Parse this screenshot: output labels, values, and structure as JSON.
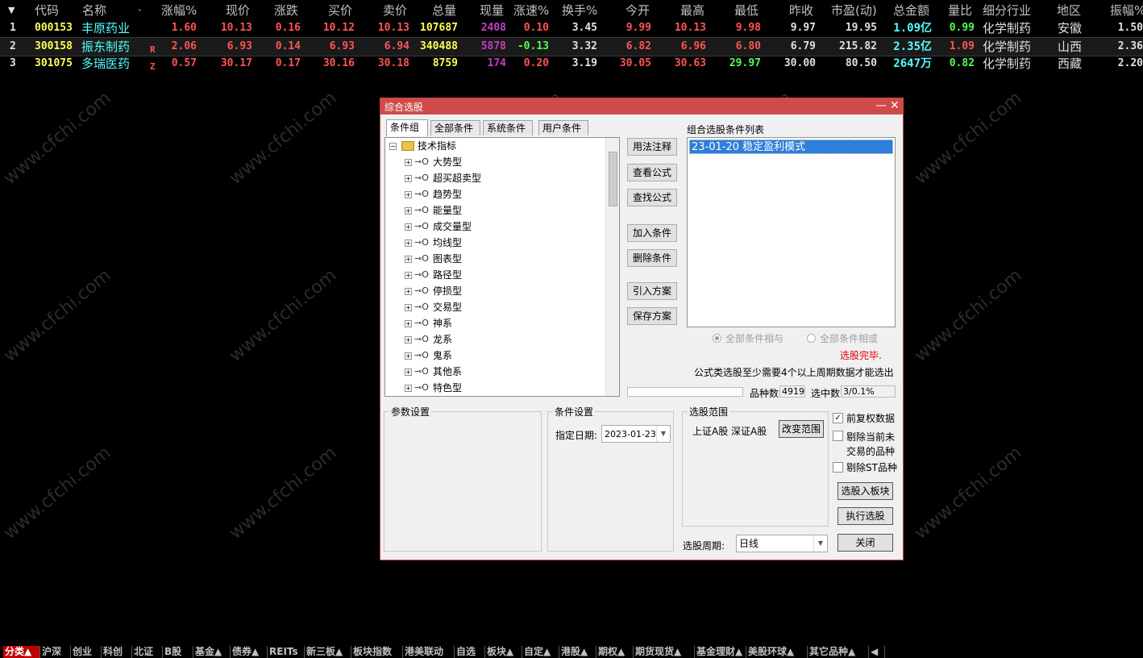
{
  "colors": {
    "yellow": "#ffff54",
    "cyan": "#54ffff",
    "red": "#ff5454",
    "green": "#54ff54",
    "magenta": "#c040c0",
    "white": "#e0e0e0",
    "grey": "#c0c0c0"
  },
  "table": {
    "headers": {
      "arrow": "▼",
      "code": "代码",
      "name": "名称",
      "dot": "·",
      "pct": "涨幅%",
      "price": "现价",
      "chg": "涨跌",
      "bid": "买价",
      "ask": "卖价",
      "vol": "总量",
      "cur": "现量",
      "speed": "涨速%",
      "turn": "换手%",
      "open": "今开",
      "high": "最高",
      "low": "最低",
      "prev": "昨收",
      "pe": "市盈(动)",
      "amt": "总金额",
      "vr": "量比",
      "ind": "细分行业",
      "area": "地区",
      "amp": "振幅%"
    },
    "rows": [
      {
        "idx": "1",
        "code": "000153",
        "name": "丰原药业",
        "flag": "",
        "pct": "1.60",
        "price": "10.13",
        "chg": "0.16",
        "bid": "10.12",
        "ask": "10.13",
        "vol": "107687",
        "cur": "2408",
        "speed": "0.10",
        "turn": "3.45",
        "open": "9.99",
        "high": "10.13",
        "low": "9.98",
        "prev": "9.97",
        "pe": "19.95",
        "amt": "1.09亿",
        "vr": "0.99",
        "ind": "化学制药",
        "area": "安徽",
        "amp": "1.50"
      },
      {
        "idx": "2",
        "code": "300158",
        "name": "振东制药",
        "flag": "R",
        "pct": "2.06",
        "price": "6.93",
        "chg": "0.14",
        "bid": "6.93",
        "ask": "6.94",
        "vol": "340488",
        "cur": "5878",
        "speed": "-0.13",
        "turn": "3.32",
        "open": "6.82",
        "high": "6.96",
        "low": "6.80",
        "prev": "6.79",
        "pe": "215.82",
        "amt": "2.35亿",
        "vr": "1.09",
        "ind": "化学制药",
        "area": "山西",
        "amp": "2.36"
      },
      {
        "idx": "3",
        "code": "301075",
        "name": "多瑞医药",
        "flag": "Z",
        "pct": "0.57",
        "price": "30.17",
        "chg": "0.17",
        "bid": "30.16",
        "ask": "30.18",
        "vol": "8759",
        "cur": "174",
        "speed": "0.20",
        "turn": "3.19",
        "open": "30.05",
        "high": "30.63",
        "low": "29.97",
        "prev": "30.00",
        "pe": "80.50",
        "amt": "2647万",
        "vr": "0.82",
        "ind": "化学制药",
        "area": "西藏",
        "amp": "2.20"
      }
    ]
  },
  "watermark": "www.cfchi.com",
  "dialog": {
    "title": "综合选股",
    "minimize": "—",
    "close": "✕",
    "tabs": [
      "条件组",
      "全部条件",
      "系统条件",
      "用户条件"
    ],
    "tree_root": "技术指标",
    "tree_items": [
      "大势型",
      "超买超卖型",
      "趋势型",
      "能量型",
      "成交量型",
      "均线型",
      "图表型",
      "路径型",
      "停损型",
      "交易型",
      "神系",
      "龙系",
      "鬼系",
      "其他系",
      "特色型"
    ],
    "buttons": {
      "usage": "用法注释",
      "view": "查看公式",
      "find": "查找公式",
      "add": "加入条件",
      "delete": "删除条件",
      "import": "引入方案",
      "save": "保存方案",
      "change_range": "改变范围",
      "to_block": "选股入板块",
      "execute": "执行选股",
      "close": "关闭"
    },
    "list_title": "组合选股条件列表",
    "list_items": [
      "23-01-20 稳定盈利模式"
    ],
    "radio_and": "全部条件相与",
    "radio_or": "全部条件相或",
    "status": "选股完毕.",
    "note": "公式类选股至少需要4个以上周期数据才能选出",
    "count_label": "品种数",
    "count_value": "4919",
    "selected_label": "选中数",
    "selected_value": "3/0.1%",
    "param_title": "参数设置",
    "cond_title": "条件设置",
    "date_label": "指定日期:",
    "date_value": "2023-01-23",
    "range_title": "选股范围",
    "range_value": "上证A股 深证A股",
    "period_label": "选股周期:",
    "period_value": "日线",
    "chk_fq": "前复权数据",
    "chk_fq_checked": true,
    "chk_notrade_1": "剔除当前未",
    "chk_notrade_2": "交易的品种",
    "chk_st": "剔除ST品种"
  },
  "bottom_tabs": [
    "分类▲",
    "沪深",
    "创业",
    "科创",
    "北证",
    "B股",
    "基金▲",
    "债券▲",
    "REITs",
    "新三板▲",
    "板块指数",
    "港美联动",
    "自选",
    "板块▲",
    "自定▲",
    "港股▲",
    "期权▲",
    "期货现货▲",
    "基金理财▲",
    "美股环球▲",
    "其它品种▲",
    "◀"
  ]
}
